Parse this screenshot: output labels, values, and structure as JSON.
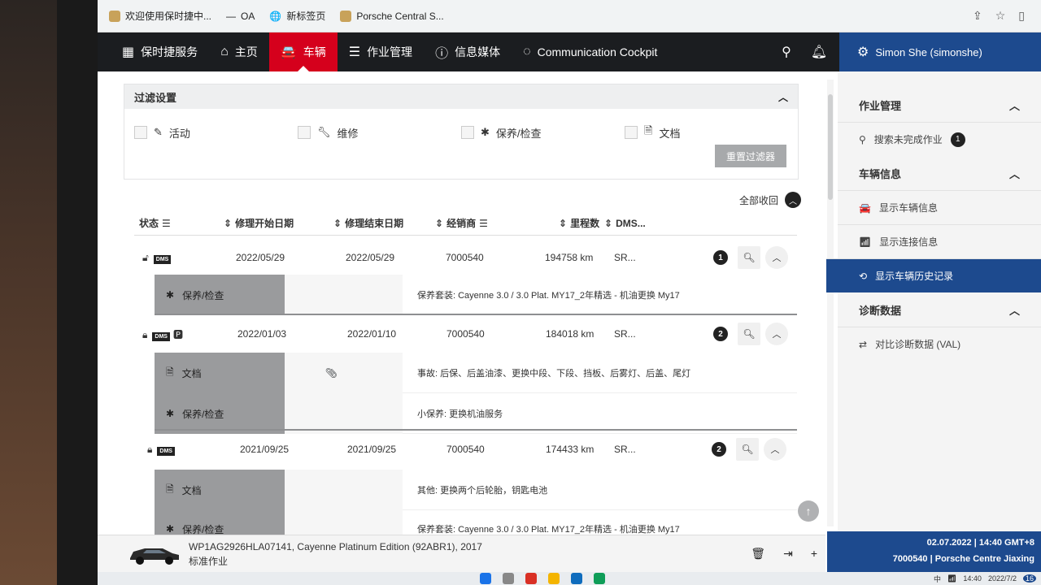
{
  "browser": {
    "bookmarks": [
      "欢迎使用保时捷中...",
      "OA",
      "新标签页",
      "Porsche Central S..."
    ]
  },
  "nav": {
    "brand": "保时捷服务",
    "home": "主页",
    "vehicle": "车辆",
    "jobs": "作业管理",
    "infomedia": "信息媒体",
    "cockpit": "Communication Cockpit",
    "user": "Simon She (simonshe)"
  },
  "filter": {
    "title": "过滤设置",
    "options": [
      "活动",
      "维修",
      "保养/检查",
      "文档"
    ],
    "reset": "重置过滤器"
  },
  "collapse_all": "全部收回",
  "columns": [
    "状态",
    "修理开始日期",
    "修理结束日期",
    "经销商",
    "里程数",
    "DMS..."
  ],
  "rows": [
    {
      "start": "2022/05/29",
      "end": "2022/05/29",
      "dealer": "7000540",
      "mileage": "194758 km",
      "dms": "SR...",
      "count": "1",
      "subs": [
        {
          "tag": "保养/检查",
          "desc": "保养套装: Cayenne 3.0 / 3.0 Plat. MY17_2年精选 - 机油更换 My17"
        }
      ]
    },
    {
      "start": "2022/01/03",
      "end": "2022/01/10",
      "dealer": "7000540",
      "mileage": "184018 km",
      "dms": "SR...",
      "count": "2",
      "subs": [
        {
          "tag": "文档",
          "desc": "事故: 后保、后盖油漆、更换中段、下段、挡板、后雾灯、后盖、尾灯"
        },
        {
          "tag": "保养/检查",
          "desc": "小保养: 更换机油服务"
        }
      ]
    },
    {
      "start": "2021/09/25",
      "end": "2021/09/25",
      "dealer": "7000540",
      "mileage": "174433 km",
      "dms": "SR...",
      "count": "2",
      "subs": [
        {
          "tag": "文档",
          "desc": "其他: 更换两个后轮胎，钥匙电池"
        },
        {
          "tag": "保养/检查",
          "desc": "保养套装: Cayenne 3.0 / 3.0 Plat. MY17_2年精选 - 机油更换 My17"
        }
      ]
    }
  ],
  "sidebar": {
    "sec1": "作业管理",
    "search_open": "搜索未完成作业",
    "search_count": "1",
    "sec2": "车辆信息",
    "show_vehicle": "显示车辆信息",
    "show_conn": "显示连接信息",
    "show_history": "显示车辆历史记录",
    "sec3": "诊断数据",
    "compare": "对比诊断数据 (VAL)"
  },
  "vehicle": {
    "line1": "WP1AG2926HLA07141, Cayenne Platinum Edition (92ABR1), 2017",
    "line2": "标准作业"
  },
  "status": {
    "datetime": "02.07.2022 | 14:40 GMT+8",
    "dealer": "7000540 | Porsche Centre Jiaxing"
  },
  "taskbar": {
    "time": "14:40",
    "date": "2022/7/2",
    "notif": "16",
    "lang": "中"
  },
  "colors": {
    "red": "#d5001c",
    "blue": "#1d4a8e",
    "dark": "#1b1d20"
  }
}
